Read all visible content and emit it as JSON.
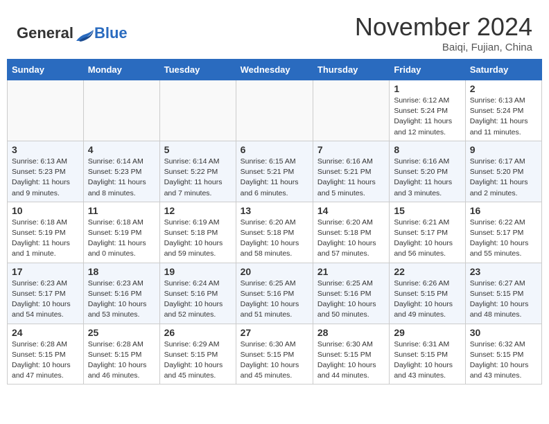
{
  "header": {
    "logo_general": "General",
    "logo_blue": "Blue",
    "month_title": "November 2024",
    "subtitle": "Baiqi, Fujian, China"
  },
  "weekdays": [
    "Sunday",
    "Monday",
    "Tuesday",
    "Wednesday",
    "Thursday",
    "Friday",
    "Saturday"
  ],
  "weeks": [
    [
      {
        "day": "",
        "info": ""
      },
      {
        "day": "",
        "info": ""
      },
      {
        "day": "",
        "info": ""
      },
      {
        "day": "",
        "info": ""
      },
      {
        "day": "",
        "info": ""
      },
      {
        "day": "1",
        "info": "Sunrise: 6:12 AM\nSunset: 5:24 PM\nDaylight: 11 hours and 12 minutes."
      },
      {
        "day": "2",
        "info": "Sunrise: 6:13 AM\nSunset: 5:24 PM\nDaylight: 11 hours and 11 minutes."
      }
    ],
    [
      {
        "day": "3",
        "info": "Sunrise: 6:13 AM\nSunset: 5:23 PM\nDaylight: 11 hours and 9 minutes."
      },
      {
        "day": "4",
        "info": "Sunrise: 6:14 AM\nSunset: 5:23 PM\nDaylight: 11 hours and 8 minutes."
      },
      {
        "day": "5",
        "info": "Sunrise: 6:14 AM\nSunset: 5:22 PM\nDaylight: 11 hours and 7 minutes."
      },
      {
        "day": "6",
        "info": "Sunrise: 6:15 AM\nSunset: 5:21 PM\nDaylight: 11 hours and 6 minutes."
      },
      {
        "day": "7",
        "info": "Sunrise: 6:16 AM\nSunset: 5:21 PM\nDaylight: 11 hours and 5 minutes."
      },
      {
        "day": "8",
        "info": "Sunrise: 6:16 AM\nSunset: 5:20 PM\nDaylight: 11 hours and 3 minutes."
      },
      {
        "day": "9",
        "info": "Sunrise: 6:17 AM\nSunset: 5:20 PM\nDaylight: 11 hours and 2 minutes."
      }
    ],
    [
      {
        "day": "10",
        "info": "Sunrise: 6:18 AM\nSunset: 5:19 PM\nDaylight: 11 hours and 1 minute."
      },
      {
        "day": "11",
        "info": "Sunrise: 6:18 AM\nSunset: 5:19 PM\nDaylight: 11 hours and 0 minutes."
      },
      {
        "day": "12",
        "info": "Sunrise: 6:19 AM\nSunset: 5:18 PM\nDaylight: 10 hours and 59 minutes."
      },
      {
        "day": "13",
        "info": "Sunrise: 6:20 AM\nSunset: 5:18 PM\nDaylight: 10 hours and 58 minutes."
      },
      {
        "day": "14",
        "info": "Sunrise: 6:20 AM\nSunset: 5:18 PM\nDaylight: 10 hours and 57 minutes."
      },
      {
        "day": "15",
        "info": "Sunrise: 6:21 AM\nSunset: 5:17 PM\nDaylight: 10 hours and 56 minutes."
      },
      {
        "day": "16",
        "info": "Sunrise: 6:22 AM\nSunset: 5:17 PM\nDaylight: 10 hours and 55 minutes."
      }
    ],
    [
      {
        "day": "17",
        "info": "Sunrise: 6:23 AM\nSunset: 5:17 PM\nDaylight: 10 hours and 54 minutes."
      },
      {
        "day": "18",
        "info": "Sunrise: 6:23 AM\nSunset: 5:16 PM\nDaylight: 10 hours and 53 minutes."
      },
      {
        "day": "19",
        "info": "Sunrise: 6:24 AM\nSunset: 5:16 PM\nDaylight: 10 hours and 52 minutes."
      },
      {
        "day": "20",
        "info": "Sunrise: 6:25 AM\nSunset: 5:16 PM\nDaylight: 10 hours and 51 minutes."
      },
      {
        "day": "21",
        "info": "Sunrise: 6:25 AM\nSunset: 5:16 PM\nDaylight: 10 hours and 50 minutes."
      },
      {
        "day": "22",
        "info": "Sunrise: 6:26 AM\nSunset: 5:15 PM\nDaylight: 10 hours and 49 minutes."
      },
      {
        "day": "23",
        "info": "Sunrise: 6:27 AM\nSunset: 5:15 PM\nDaylight: 10 hours and 48 minutes."
      }
    ],
    [
      {
        "day": "24",
        "info": "Sunrise: 6:28 AM\nSunset: 5:15 PM\nDaylight: 10 hours and 47 minutes."
      },
      {
        "day": "25",
        "info": "Sunrise: 6:28 AM\nSunset: 5:15 PM\nDaylight: 10 hours and 46 minutes."
      },
      {
        "day": "26",
        "info": "Sunrise: 6:29 AM\nSunset: 5:15 PM\nDaylight: 10 hours and 45 minutes."
      },
      {
        "day": "27",
        "info": "Sunrise: 6:30 AM\nSunset: 5:15 PM\nDaylight: 10 hours and 45 minutes."
      },
      {
        "day": "28",
        "info": "Sunrise: 6:30 AM\nSunset: 5:15 PM\nDaylight: 10 hours and 44 minutes."
      },
      {
        "day": "29",
        "info": "Sunrise: 6:31 AM\nSunset: 5:15 PM\nDaylight: 10 hours and 43 minutes."
      },
      {
        "day": "30",
        "info": "Sunrise: 6:32 AM\nSunset: 5:15 PM\nDaylight: 10 hours and 43 minutes."
      }
    ]
  ]
}
